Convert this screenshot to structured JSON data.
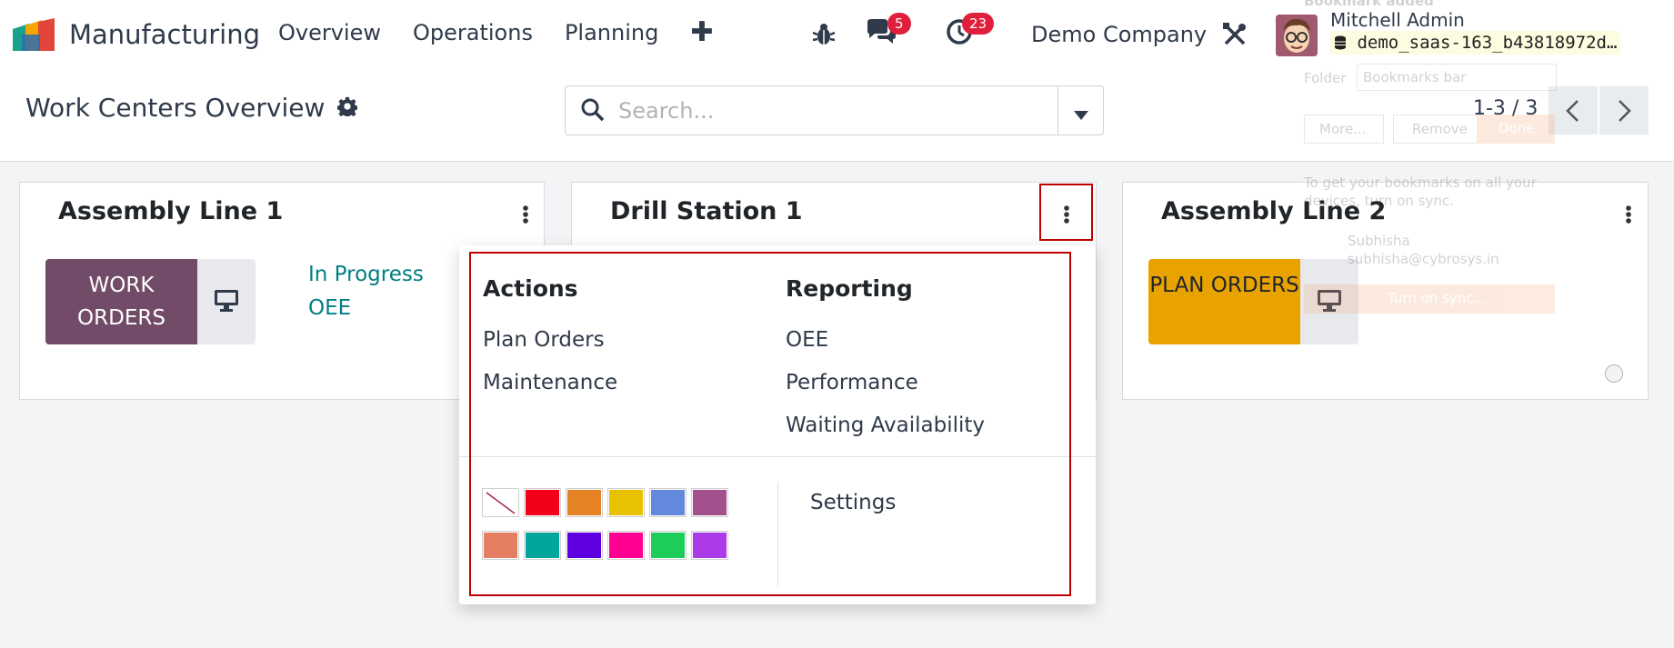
{
  "navbar": {
    "app_name": "Manufacturing",
    "menu": [
      "Overview",
      "Operations",
      "Planning"
    ],
    "plus": "✚",
    "messages_count": "5",
    "activities_count": "23",
    "company": "Demo Company",
    "user_name": "Mitchell Admin",
    "database": "demo_saas-163_b43818972d…"
  },
  "control_panel": {
    "title": "Work Centers Overview",
    "search_placeholder": "Search...",
    "pager": "1-3 / 3"
  },
  "cards": [
    {
      "title": "Assembly Line 1",
      "button": "WORK ORDERS",
      "button_color": "#714b67",
      "links": [
        "In Progress",
        "OEE"
      ]
    },
    {
      "title": "Drill Station 1"
    },
    {
      "title": "Assembly Line 2",
      "button": "PLAN ORDERS",
      "button_color": "#e9a300"
    }
  ],
  "dropdown": {
    "actions_header": "Actions",
    "actions": [
      "Plan Orders",
      "Maintenance"
    ],
    "reporting_header": "Reporting",
    "reporting": [
      "OEE",
      "Performance",
      "Waiting Availability"
    ],
    "settings": "Settings",
    "colors": [
      "#ffffff",
      "#f2001a",
      "#e58324",
      "#e8c100",
      "#6389dc",
      "#a2518d",
      "#e48061",
      "#00a69b",
      "#5e00e0",
      "#ff0093",
      "#1ecc5c",
      "#ab3ae8"
    ]
  },
  "bookmark_ghost": {
    "header": "Bookmark added",
    "folder_label": "Folder",
    "folder_value": "Bookmarks bar",
    "more": "More...",
    "remove": "Remove",
    "done": "Done",
    "sync_text_1": "To get your bookmarks on all your",
    "sync_text_2": "devices, turn on sync.",
    "account_name": "Subhisha",
    "account_email": "subhisha@cybrosys.in",
    "sync_button": "Turn on sync..."
  }
}
